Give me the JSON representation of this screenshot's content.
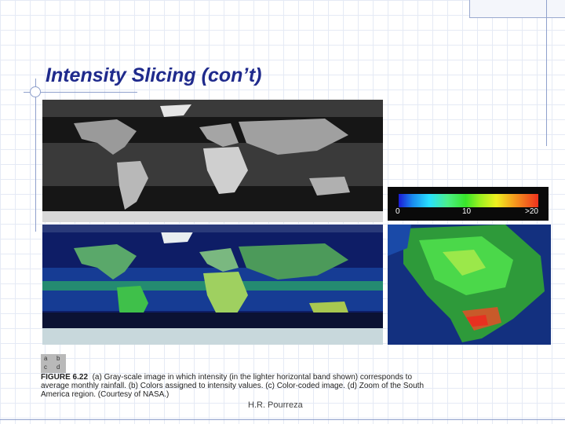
{
  "slide": {
    "title": "Intensity Slicing (con’t)",
    "footer": "H.R. Pourreza"
  },
  "colorbar": {
    "ticks": [
      "0",
      "10",
      ">20"
    ],
    "colors": [
      "#1b1bd6",
      "#28e0ff",
      "#38e52a",
      "#f0f020",
      "#f0321e"
    ]
  },
  "figure": {
    "panel_letters": [
      "a",
      "b",
      "c",
      "d"
    ],
    "number": "FIGURE 6.22",
    "caption_line1": "(a) Gray-scale image in which intensity (in the lighter horizontal band shown) corresponds to",
    "caption_line2": "average monthly rainfall. (b) Colors assigned to intensity values. (c) Color-coded image. (d) Zoom of the South",
    "caption_line3": "America region. (Courtesy of NASA.)"
  }
}
